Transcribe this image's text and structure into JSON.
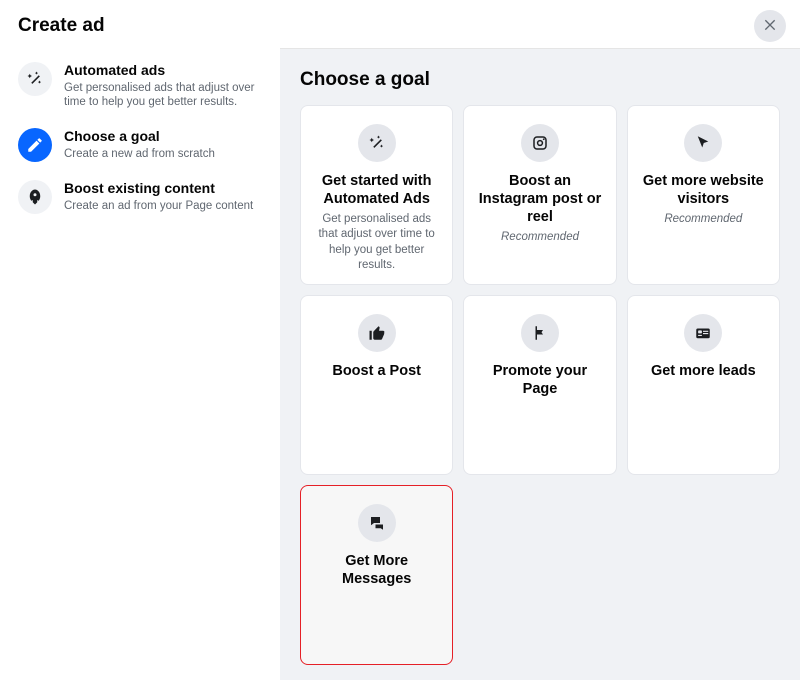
{
  "header": {
    "title": "Create ad"
  },
  "sidebar": {
    "items": [
      {
        "title": "Automated ads",
        "sub": "Get personalised ads that adjust over time to help you get better results."
      },
      {
        "title": "Choose a goal",
        "sub": "Create a new ad from scratch"
      },
      {
        "title": "Boost existing content",
        "sub": "Create an ad from your Page content"
      }
    ]
  },
  "main": {
    "heading": "Choose a goal",
    "cards": [
      {
        "title": "Get started with Automated Ads",
        "sub": "Get personalised ads that adjust over time to help you get better results."
      },
      {
        "title": "Boost an Instagram post or reel",
        "sub": "Recommended"
      },
      {
        "title": "Get more website visitors",
        "sub": "Recommended"
      },
      {
        "title": "Boost a Post",
        "sub": ""
      },
      {
        "title": "Promote your Page",
        "sub": ""
      },
      {
        "title": "Get more leads",
        "sub": ""
      },
      {
        "title": "Get More Messages",
        "sub": ""
      }
    ]
  }
}
